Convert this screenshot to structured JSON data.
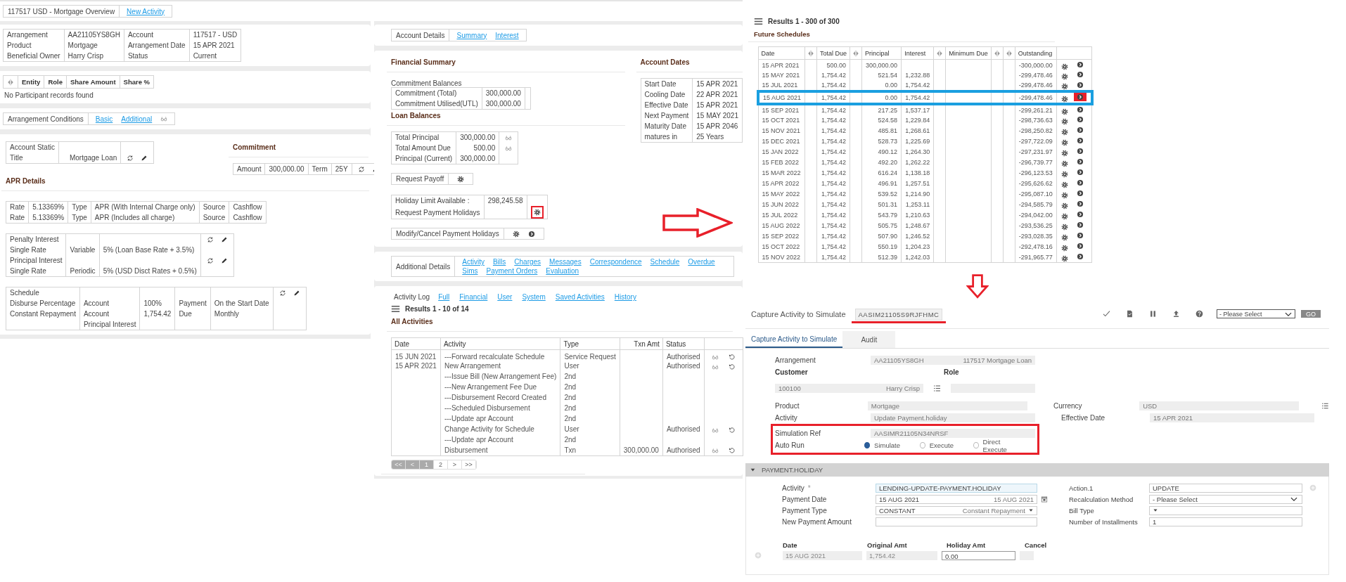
{
  "header": {
    "title": "117517 USD - Mortgage Overview",
    "link": "New Activity"
  },
  "arrangement": {
    "rows": [
      [
        "Arrangement",
        "AA21105YS8GH",
        "Account",
        "117517 - USD"
      ],
      [
        "Product",
        "Mortgage",
        "Arrangement Date",
        "15 APR 2021"
      ],
      [
        "Beneficial Owner",
        "Harry Crisp",
        "Status",
        "Current"
      ]
    ]
  },
  "participants": {
    "columns": [
      "Entity",
      "Role",
      "Share Amount",
      "Share %"
    ],
    "message": "No Participant records found"
  },
  "conditions": {
    "label": "Arrangement Conditions",
    "links": [
      "Basic",
      "Additional"
    ]
  },
  "account_static": {
    "rows": [
      {
        "cells": [
          "Account Static",
          null
        ],
        "actions": false
      },
      {
        "cells": [
          "Title",
          "Mortgage Loan"
        ],
        "actions": true
      }
    ]
  },
  "commitment": {
    "title": "Commitment",
    "rows": [
      {
        "cells": [
          "Amount",
          "300,000.00",
          "Term",
          "25Y"
        ],
        "actions": true
      }
    ]
  },
  "apr": {
    "title": "APR Details",
    "rows": [
      [
        "Rate",
        "5.13369%",
        "Type",
        "APR (With Internal Charge only)",
        "Source",
        "Cashflow"
      ],
      [
        "Rate",
        "5.13369%",
        "Type",
        "APR (Includes all charge)",
        "Source",
        "Cashflow"
      ]
    ]
  },
  "interest": {
    "rows": [
      {
        "cells": [
          "Penalty Interest",
          null,
          null
        ],
        "actions": true
      },
      {
        "cells": [
          "Single Rate",
          "Variable",
          "5% (Loan Base Rate + 3.5%)"
        ],
        "actions": false
      },
      {
        "cells": [
          "Principal Interest",
          null,
          null
        ],
        "actions": true
      },
      {
        "cells": [
          "Single Rate",
          "Periodic",
          "5% (USD Disct Rates + 0.5%)"
        ],
        "actions": false
      }
    ]
  },
  "schedule": {
    "rows": [
      {
        "cells": [
          "Schedule",
          null,
          null,
          null,
          null
        ],
        "actions": true
      },
      {
        "cells": [
          "Disburse Percentage",
          "Account",
          "100%",
          "Payment",
          "On the Start Date"
        ],
        "actions": false
      },
      {
        "cells": [
          "Constant Repayment",
          "Account",
          "1,754.42",
          "Due",
          "Monthly"
        ],
        "actions": false
      },
      {
        "cells": [
          null,
          "Principal Interest",
          null,
          null,
          null
        ],
        "actions": false
      }
    ]
  },
  "account_details": {
    "label": "Account Details",
    "links": [
      "Summary",
      "Interest"
    ]
  },
  "financial_summary": {
    "title": "Financial Summary",
    "balances_label": "Commitment Balances",
    "balances": [
      [
        "Commitment (Total)",
        "300,000.00"
      ],
      [
        "Commitment Utilised(UTL)",
        "300,000.00"
      ]
    ],
    "loan_title": "Loan Balances",
    "loans": [
      {
        "cells": [
          "Total Principal",
          "300,000.00"
        ],
        "view": true
      },
      {
        "cells": [
          "Total Amount Due",
          "500.00"
        ],
        "view": true
      },
      {
        "cells": [
          "Principal (Current)",
          "300,000.00"
        ],
        "view": false
      }
    ]
  },
  "payoff": {
    "label": "Request Payoff"
  },
  "holiday": {
    "limit_label": "Holiday Limit Available :",
    "limit": "298,245.58",
    "request_label": "Request Payment Holidays",
    "highlighted": true
  },
  "modify": {
    "label": "Modify/Cancel Payment Holidays"
  },
  "account_dates": {
    "title": "Account Dates",
    "rows": [
      [
        "Start Date",
        "15 APR 2021"
      ],
      [
        "Cooling Date",
        "22 APR 2021"
      ],
      [
        "Effective Date",
        "15 APR 2021"
      ],
      [
        "Next Payment",
        "15 MAY 2021"
      ],
      [
        "Maturity Date",
        "15 APR 2046"
      ],
      [
        "matures in",
        "25 Years"
      ]
    ]
  },
  "additional_details": {
    "label": "Additional Details",
    "links": [
      "Activity",
      "Bills",
      "Charges",
      "Messages",
      "Correspondence",
      "Schedule",
      "Overdue",
      "Sims",
      "Payment Orders",
      "Evaluation"
    ]
  },
  "activity_log": {
    "label": "Activity Log",
    "links": [
      "Full",
      "Financial",
      "User",
      "System",
      "Saved Activities",
      "History"
    ],
    "results": "Results 1 - 10 of 14",
    "title": "All Activities",
    "columns": [
      "Date",
      "Activity",
      "Type",
      "Txn Amt",
      "Status"
    ],
    "rows": [
      {
        "date": "15 JUN 2021",
        "activity": "---Forward recalculate Schedule",
        "type": "Service Request",
        "amount": null,
        "status": "Authorised",
        "actions": true
      },
      {
        "date": "15 APR 2021",
        "activity": "New Arrangement",
        "type": "User",
        "amount": null,
        "status": "Authorised",
        "actions": true
      },
      {
        "date": null,
        "activity": "---Issue Bill (New Arrangement Fee)",
        "type": "2nd",
        "amount": null,
        "status": null,
        "actions": false
      },
      {
        "date": null,
        "activity": "---New Arrangement Fee Due",
        "type": "2nd",
        "amount": null,
        "status": null,
        "actions": false
      },
      {
        "date": null,
        "activity": "---Disbursement Record Created",
        "type": "2nd",
        "amount": null,
        "status": null,
        "actions": false
      },
      {
        "date": null,
        "activity": "---Scheduled Disbursement",
        "type": "2nd",
        "amount": null,
        "status": null,
        "actions": false
      },
      {
        "date": null,
        "activity": "---Update apr Account",
        "type": "2nd",
        "amount": null,
        "status": null,
        "actions": false
      },
      {
        "date": null,
        "activity": "Change Activity for Schedule",
        "type": "User",
        "amount": null,
        "status": "Authorised",
        "actions": true
      },
      {
        "date": null,
        "activity": "---Update apr Account",
        "type": "2nd",
        "amount": null,
        "status": null,
        "actions": false
      },
      {
        "date": null,
        "activity": "Disbursement",
        "type": "Txn",
        "amount": "300,000.00",
        "status": "Authorised",
        "actions": true
      }
    ],
    "pages": [
      {
        "label": "<<",
        "disabled": true,
        "selected": false
      },
      {
        "label": "<",
        "disabled": true,
        "selected": false
      },
      {
        "label": "1",
        "disabled": false,
        "selected": true
      },
      {
        "label": "2",
        "disabled": false,
        "selected": false
      },
      {
        "label": ">",
        "disabled": false,
        "selected": false
      },
      {
        "label": ">>",
        "disabled": false,
        "selected": false
      }
    ]
  },
  "future_schedules": {
    "results": "Results 1 - 300 of 300",
    "title": "Future Schedules",
    "columns": [
      {
        "kind": "text",
        "label": "Date"
      },
      {
        "kind": "toggle"
      },
      {
        "kind": "text",
        "label": "Total Due"
      },
      {
        "kind": "toggle"
      },
      {
        "kind": "text",
        "label": "Principal"
      },
      {
        "kind": "text",
        "label": "Interest"
      },
      {
        "kind": "toggle"
      },
      {
        "kind": "text",
        "label": "Minimum Due"
      },
      {
        "kind": "toggle"
      },
      {
        "kind": "toggle"
      },
      {
        "kind": "text",
        "label": "Outstanding"
      },
      {
        "kind": "actions"
      }
    ],
    "rows": [
      {
        "cells": [
          "15 APR 2021",
          null,
          "500.00",
          null,
          "300,000.00",
          null,
          null,
          null,
          null,
          null,
          "-300,000.00",
          null
        ],
        "selected": false
      },
      {
        "cells": [
          "15 MAY 2021",
          null,
          "1,754.42",
          null,
          "521.54",
          "1,232.88",
          null,
          null,
          null,
          null,
          "-299,478.46",
          null
        ],
        "selected": false
      },
      {
        "cells": [
          "15 JUL 2021",
          null,
          "1,754.42",
          null,
          "0.00",
          "1,754.42",
          null,
          null,
          null,
          null,
          "-299,478.46",
          null
        ],
        "selected": false
      },
      {
        "cells": [
          "15 AUG 2021",
          null,
          "1,754.42",
          null,
          "0.00",
          "1,754.42",
          null,
          null,
          null,
          null,
          "-299,478.46",
          null
        ],
        "selected": true
      },
      {
        "cells": [
          "15 SEP 2021",
          null,
          "1,754.42",
          null,
          "217.25",
          "1,537.17",
          null,
          null,
          null,
          null,
          "-299,261.21",
          null
        ],
        "selected": false
      },
      {
        "cells": [
          "15 OCT 2021",
          null,
          "1,754.42",
          null,
          "524.58",
          "1,229.84",
          null,
          null,
          null,
          null,
          "-298,736.63",
          null
        ],
        "selected": false
      },
      {
        "cells": [
          "15 NOV 2021",
          null,
          "1,754.42",
          null,
          "485.81",
          "1,268.61",
          null,
          null,
          null,
          null,
          "-298,250.82",
          null
        ],
        "selected": false
      },
      {
        "cells": [
          "15 DEC 2021",
          null,
          "1,754.42",
          null,
          "528.73",
          "1,225.69",
          null,
          null,
          null,
          null,
          "-297,722.09",
          null
        ],
        "selected": false
      },
      {
        "cells": [
          "15 JAN 2022",
          null,
          "1,754.42",
          null,
          "490.12",
          "1,264.30",
          null,
          null,
          null,
          null,
          "-297,231.97",
          null
        ],
        "selected": false
      },
      {
        "cells": [
          "15 FEB 2022",
          null,
          "1,754.42",
          null,
          "492.20",
          "1,262.22",
          null,
          null,
          null,
          null,
          "-296,739.77",
          null
        ],
        "selected": false
      },
      {
        "cells": [
          "15 MAR 2022",
          null,
          "1,754.42",
          null,
          "616.24",
          "1,138.18",
          null,
          null,
          null,
          null,
          "-296,123.53",
          null
        ],
        "selected": false
      },
      {
        "cells": [
          "15 APR 2022",
          null,
          "1,754.42",
          null,
          "496.91",
          "1,257.51",
          null,
          null,
          null,
          null,
          "-295,626.62",
          null
        ],
        "selected": false
      },
      {
        "cells": [
          "15 MAY 2022",
          null,
          "1,754.42",
          null,
          "539.52",
          "1,214.90",
          null,
          null,
          null,
          null,
          "-295,087.10",
          null
        ],
        "selected": false
      },
      {
        "cells": [
          "15 JUN 2022",
          null,
          "1,754.42",
          null,
          "501.31",
          "1,253.11",
          null,
          null,
          null,
          null,
          "-294,585.79",
          null
        ],
        "selected": false
      },
      {
        "cells": [
          "15 JUL 2022",
          null,
          "1,754.42",
          null,
          "543.79",
          "1,210.63",
          null,
          null,
          null,
          null,
          "-294,042.00",
          null
        ],
        "selected": false
      },
      {
        "cells": [
          "15 AUG 2022",
          null,
          "1,754.42",
          null,
          "505.75",
          "1,248.67",
          null,
          null,
          null,
          null,
          "-293,536.25",
          null
        ],
        "selected": false
      },
      {
        "cells": [
          "15 SEP 2022",
          null,
          "1,754.42",
          null,
          "507.90",
          "1,246.52",
          null,
          null,
          null,
          null,
          "-293,028.35",
          null
        ],
        "selected": false
      },
      {
        "cells": [
          "15 OCT 2022",
          null,
          "1,754.42",
          null,
          "550.19",
          "1,204.23",
          null,
          null,
          null,
          null,
          "-292,478.16",
          null
        ],
        "selected": false
      },
      {
        "cells": [
          "15 NOV 2022",
          null,
          "1,754.42",
          null,
          "512.39",
          "1,242.03",
          null,
          null,
          null,
          null,
          "-291,965.77",
          null
        ],
        "selected": false
      }
    ]
  },
  "capture": {
    "title": "Capture Activity to Simulate",
    "reference": "AASIM21105S9RJFHMC",
    "reference_marked": true,
    "select": {
      "value": "- Please Select"
    },
    "go": "GO",
    "tabs": [
      {
        "label": "Capture Activity to Simulate",
        "selected": true
      },
      {
        "label": "Audit",
        "selected": false
      }
    ],
    "arrangement": {
      "label": "Arrangement",
      "value": "AA21105YS8GH",
      "description": "117517 Mortgage Loan"
    },
    "customer": {
      "label": "Customer",
      "value": "100100",
      "description": "Harry Crisp"
    },
    "role": {
      "label": "Role"
    },
    "product": {
      "label": "Product",
      "value": "Mortgage"
    },
    "currency": {
      "label": "Currency",
      "value": "USD"
    },
    "activity": {
      "label": "Activity",
      "value": "Update Payment.holiday"
    },
    "effective_date": {
      "label": "Effective Date",
      "value": "15 APR 2021"
    },
    "simulation_ref": {
      "label": "Simulation Ref",
      "value": "AASIMR21105N34NRSF"
    },
    "auto_run": {
      "label": "Auto Run",
      "options": [
        {
          "label": "Simulate",
          "selected": true
        },
        {
          "label": "Execute",
          "selected": false
        },
        {
          "label": "Direct Execute",
          "selected": false
        }
      ]
    },
    "simulation_marked": true
  },
  "payment_holiday": {
    "title": "PAYMENT.HOLIDAY",
    "expanded": true,
    "left": [
      {
        "label": "Activity",
        "required": "*",
        "value": "LENDING-UPDATE-PAYMENT.HOLIDAY",
        "kind": "text",
        "focused": true,
        "repeatable": false
      },
      {
        "label": "Payment Date",
        "value": "15 AUG 2021",
        "description": "15 AUG 2021",
        "kind": "date",
        "focused": false,
        "repeatable": false
      },
      {
        "label": "Payment Type",
        "value": "CONSTANT",
        "description": "Constant Repayment",
        "kind": "dropdown",
        "focused": false,
        "repeatable": false
      },
      {
        "label": "New Payment Amount",
        "kind": "text",
        "focused": false,
        "repeatable": false
      }
    ],
    "right": [
      {
        "label": "Action.1",
        "value": "UPDATE",
        "kind": "text",
        "focused": false,
        "repeatable": true
      },
      {
        "label": "Recalculation Method",
        "value": "- Please Select",
        "kind": "select",
        "focused": false,
        "repeatable": false
      },
      {
        "label": "Bill Type",
        "kind": "dropdown",
        "focused": false,
        "repeatable": false
      },
      {
        "label": "Number of Installments",
        "value": "1",
        "kind": "text",
        "focused": false,
        "repeatable": false
      }
    ],
    "grid": {
      "columns": [
        "Date",
        "Original Amt",
        "Holiday Amt",
        "Cancel"
      ],
      "rows": [
        {
          "repeatable": true,
          "cells": [
            {
              "value": "15 AUG 2021",
              "editable": false
            },
            {
              "value": "1,754.42",
              "editable": false
            },
            {
              "value": "0.00",
              "editable": true
            },
            {
              "editable": false
            }
          ]
        }
      ]
    }
  }
}
